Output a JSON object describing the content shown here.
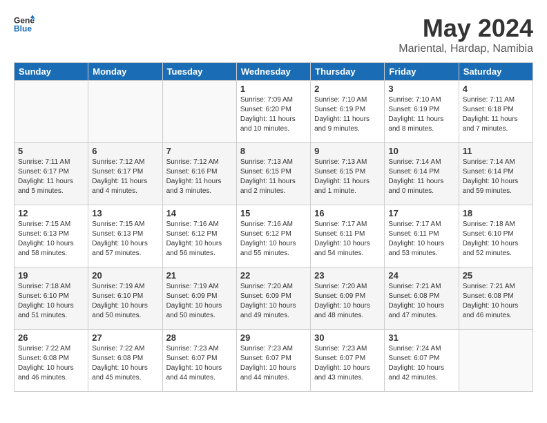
{
  "logo": {
    "line1": "General",
    "line2": "Blue"
  },
  "title": "May 2024",
  "subtitle": "Mariental, Hardap, Namibia",
  "headers": [
    "Sunday",
    "Monday",
    "Tuesday",
    "Wednesday",
    "Thursday",
    "Friday",
    "Saturday"
  ],
  "weeks": [
    [
      {
        "day": "",
        "info": ""
      },
      {
        "day": "",
        "info": ""
      },
      {
        "day": "",
        "info": ""
      },
      {
        "day": "1",
        "info": "Sunrise: 7:09 AM\nSunset: 6:20 PM\nDaylight: 11 hours\nand 10 minutes."
      },
      {
        "day": "2",
        "info": "Sunrise: 7:10 AM\nSunset: 6:19 PM\nDaylight: 11 hours\nand 9 minutes."
      },
      {
        "day": "3",
        "info": "Sunrise: 7:10 AM\nSunset: 6:19 PM\nDaylight: 11 hours\nand 8 minutes."
      },
      {
        "day": "4",
        "info": "Sunrise: 7:11 AM\nSunset: 6:18 PM\nDaylight: 11 hours\nand 7 minutes."
      }
    ],
    [
      {
        "day": "5",
        "info": "Sunrise: 7:11 AM\nSunset: 6:17 PM\nDaylight: 11 hours\nand 5 minutes."
      },
      {
        "day": "6",
        "info": "Sunrise: 7:12 AM\nSunset: 6:17 PM\nDaylight: 11 hours\nand 4 minutes."
      },
      {
        "day": "7",
        "info": "Sunrise: 7:12 AM\nSunset: 6:16 PM\nDaylight: 11 hours\nand 3 minutes."
      },
      {
        "day": "8",
        "info": "Sunrise: 7:13 AM\nSunset: 6:15 PM\nDaylight: 11 hours\nand 2 minutes."
      },
      {
        "day": "9",
        "info": "Sunrise: 7:13 AM\nSunset: 6:15 PM\nDaylight: 11 hours\nand 1 minute."
      },
      {
        "day": "10",
        "info": "Sunrise: 7:14 AM\nSunset: 6:14 PM\nDaylight: 11 hours\nand 0 minutes."
      },
      {
        "day": "11",
        "info": "Sunrise: 7:14 AM\nSunset: 6:14 PM\nDaylight: 10 hours\nand 59 minutes."
      }
    ],
    [
      {
        "day": "12",
        "info": "Sunrise: 7:15 AM\nSunset: 6:13 PM\nDaylight: 10 hours\nand 58 minutes."
      },
      {
        "day": "13",
        "info": "Sunrise: 7:15 AM\nSunset: 6:13 PM\nDaylight: 10 hours\nand 57 minutes."
      },
      {
        "day": "14",
        "info": "Sunrise: 7:16 AM\nSunset: 6:12 PM\nDaylight: 10 hours\nand 56 minutes."
      },
      {
        "day": "15",
        "info": "Sunrise: 7:16 AM\nSunset: 6:12 PM\nDaylight: 10 hours\nand 55 minutes."
      },
      {
        "day": "16",
        "info": "Sunrise: 7:17 AM\nSunset: 6:11 PM\nDaylight: 10 hours\nand 54 minutes."
      },
      {
        "day": "17",
        "info": "Sunrise: 7:17 AM\nSunset: 6:11 PM\nDaylight: 10 hours\nand 53 minutes."
      },
      {
        "day": "18",
        "info": "Sunrise: 7:18 AM\nSunset: 6:10 PM\nDaylight: 10 hours\nand 52 minutes."
      }
    ],
    [
      {
        "day": "19",
        "info": "Sunrise: 7:18 AM\nSunset: 6:10 PM\nDaylight: 10 hours\nand 51 minutes."
      },
      {
        "day": "20",
        "info": "Sunrise: 7:19 AM\nSunset: 6:10 PM\nDaylight: 10 hours\nand 50 minutes."
      },
      {
        "day": "21",
        "info": "Sunrise: 7:19 AM\nSunset: 6:09 PM\nDaylight: 10 hours\nand 50 minutes."
      },
      {
        "day": "22",
        "info": "Sunrise: 7:20 AM\nSunset: 6:09 PM\nDaylight: 10 hours\nand 49 minutes."
      },
      {
        "day": "23",
        "info": "Sunrise: 7:20 AM\nSunset: 6:09 PM\nDaylight: 10 hours\nand 48 minutes."
      },
      {
        "day": "24",
        "info": "Sunrise: 7:21 AM\nSunset: 6:08 PM\nDaylight: 10 hours\nand 47 minutes."
      },
      {
        "day": "25",
        "info": "Sunrise: 7:21 AM\nSunset: 6:08 PM\nDaylight: 10 hours\nand 46 minutes."
      }
    ],
    [
      {
        "day": "26",
        "info": "Sunrise: 7:22 AM\nSunset: 6:08 PM\nDaylight: 10 hours\nand 46 minutes."
      },
      {
        "day": "27",
        "info": "Sunrise: 7:22 AM\nSunset: 6:08 PM\nDaylight: 10 hours\nand 45 minutes."
      },
      {
        "day": "28",
        "info": "Sunrise: 7:23 AM\nSunset: 6:07 PM\nDaylight: 10 hours\nand 44 minutes."
      },
      {
        "day": "29",
        "info": "Sunrise: 7:23 AM\nSunset: 6:07 PM\nDaylight: 10 hours\nand 44 minutes."
      },
      {
        "day": "30",
        "info": "Sunrise: 7:23 AM\nSunset: 6:07 PM\nDaylight: 10 hours\nand 43 minutes."
      },
      {
        "day": "31",
        "info": "Sunrise: 7:24 AM\nSunset: 6:07 PM\nDaylight: 10 hours\nand 42 minutes."
      },
      {
        "day": "",
        "info": ""
      }
    ]
  ]
}
